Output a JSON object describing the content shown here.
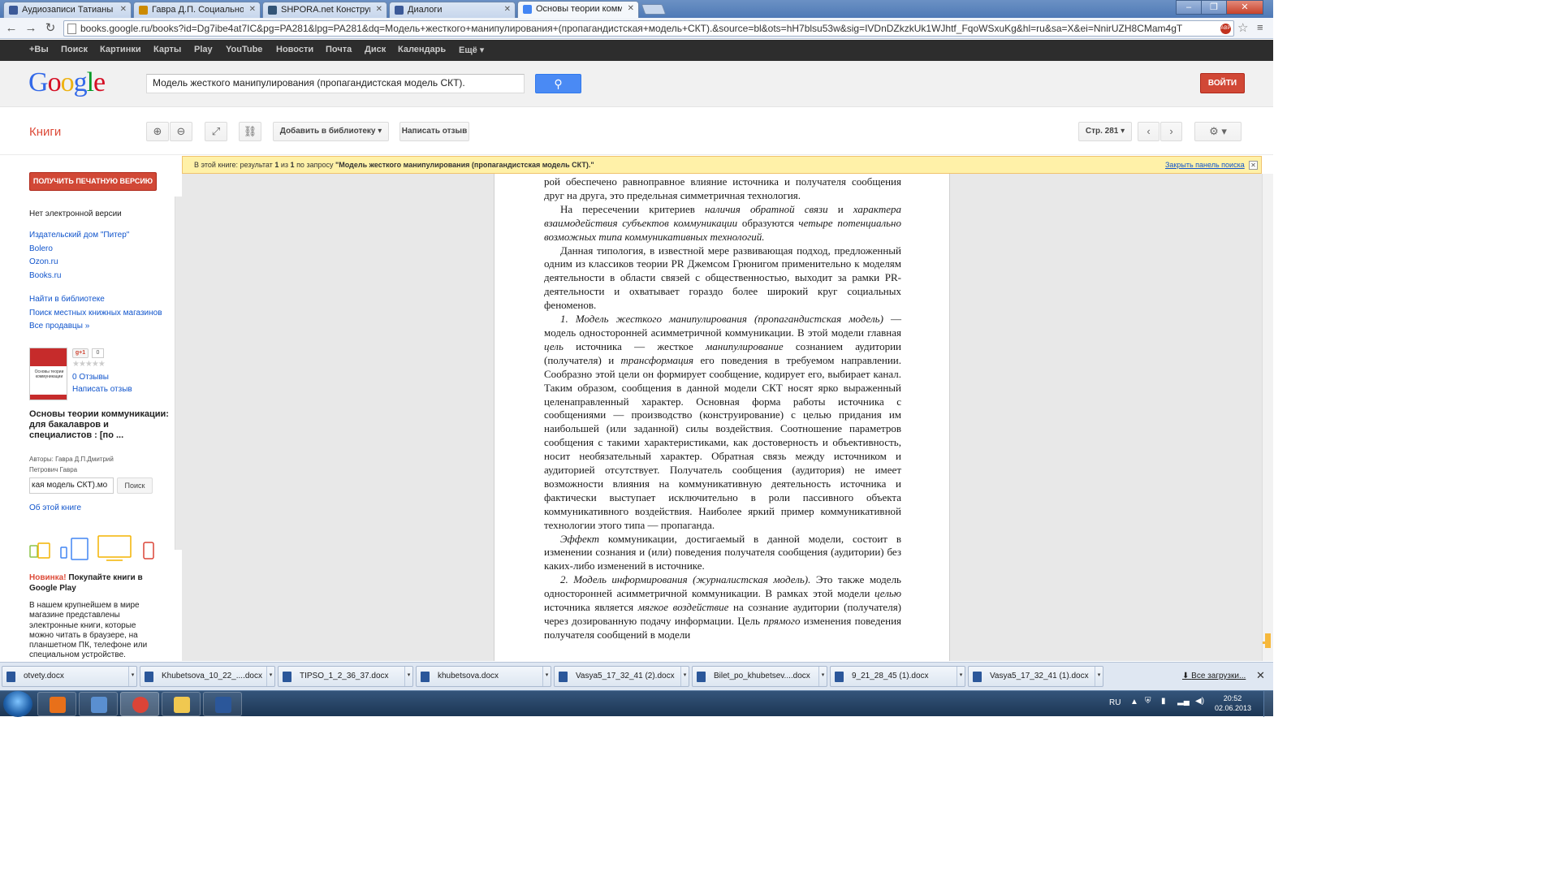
{
  "browser": {
    "tabs": [
      {
        "title": "Аудиозаписи Татианы Го",
        "icon_color": "#3b5998"
      },
      {
        "title": "Гавра Д.П. Социально-к",
        "icon_color": "#cc8a00"
      },
      {
        "title": "SHPORA.net Конструктор",
        "icon_color": "#335577"
      },
      {
        "title": "Диалоги",
        "icon_color": "#3b5998"
      },
      {
        "title": "Основы теории коммуни",
        "icon_color": "#4285f4",
        "active": true
      }
    ],
    "url": "books.google.ru/books?id=Dg7ibe4at7IC&pg=PA281&lpg=PA281&dq=Модель+жесткого+манипулирования+(пропагандистская+модель+СКТ).&source=bl&ots=hH7blsu53w&sig=IVDnDZkzkUk1WJhtf_FqoWSxuKg&hl=ru&sa=X&ei=NnirUZH8CMam4gT",
    "url_host": "books.google.ru",
    "adblock_label": "ABP"
  },
  "gbar": {
    "items": [
      "+Вы",
      "Поиск",
      "Картинки",
      "Карты",
      "Play",
      "YouTube",
      "Новости",
      "Почта",
      "Диск",
      "Календарь",
      "Ещё ▾"
    ]
  },
  "header": {
    "logo_letters": [
      {
        "ch": "G",
        "color": "#3369e8"
      },
      {
        "ch": "o",
        "color": "#d50f25"
      },
      {
        "ch": "o",
        "color": "#eeb211"
      },
      {
        "ch": "g",
        "color": "#3369e8"
      },
      {
        "ch": "l",
        "color": "#009925"
      },
      {
        "ch": "e",
        "color": "#d50f25"
      }
    ],
    "search_value": "Модель жесткого манипулирования (пропагандистская модель СКТ).",
    "signin_label": "ВОЙТИ"
  },
  "books_toolbar": {
    "title": "Книги",
    "add_library": "Добавить в библиотеку",
    "write_review": "Написать отзыв",
    "page_label": "Стр. 281"
  },
  "result_bar": {
    "prefix": "В этой книге: результат",
    "current": "1",
    "of": "из",
    "total": "1",
    "query_prefix": "по запросу",
    "query": "\"Модель жесткого манипулирования (пропагандистская модель СКТ).\"",
    "close_link": "Закрыть панель поиска",
    "close_x": "✕"
  },
  "sidebar": {
    "print_button": "ПОЛУЧИТЬ ПЕЧАТНУЮ ВЕРСИЮ",
    "no_ebook": "Нет электронной версии",
    "sellers": [
      "Издательский дом \"Питер\"",
      "Bolero",
      "Ozon.ru",
      "Books.ru"
    ],
    "library_links": [
      "Найти в библиотеке",
      "Поиск местных книжных магазинов",
      "Все продавцы »"
    ],
    "cover_title": "Основы теории коммуникации",
    "gplus_label": "g+1",
    "gplus_count": "0",
    "stars": "★★★★★",
    "reviews": "0 Отзывы",
    "write_review": "Написать отзыв",
    "book_title": "Основы теории коммуникации: для бакалавров и специалистов : [по ...",
    "authors_line1": "Авторы: Гавра Д.П.Дмитрий",
    "authors_line2": "Петрович Гавра",
    "inbook_search_value": "кая модель СКТ).мо",
    "inbook_search_btn": "Поиск",
    "about_book": "Об этой книге",
    "promo_new": "Новинка!",
    "promo_title": " Покупайте книги в Google Play",
    "promo_desc": "В нашем крупнейшем в мире магазине представлены электронные книги, которые можно читать в браузере, на планшетном ПК, телефоне или специальном устройстве."
  },
  "page": {
    "paragraphs": [
      {
        "noindent": true,
        "html": "рой обеспечено равноправное влияние источника и получателя сообщения друг на друга, это предельная симметричная технология."
      },
      {
        "html": "На пересечении критериев <i>наличия обратной связи</i> и <i>характера взаимодействия субъектов коммуникации</i> образуются <i>четыре потенциально возможных типа коммуникативных технологий.</i>"
      },
      {
        "html": "Данная типология, в известной мере развивающая подход, предложенный одним из классиков теории PR Джемсом Грюнигом применительно к моделям деятельности в области связей с общественностью, выходит за рамки PR-деятельности и охватывает гораздо более широкий круг социальных феноменов."
      },
      {
        "html": "<i>1. Модель жесткого манипулирования (пропагандистская модель)</i> — модель односторонней асимметричной коммуникации. В этой модели главная <i>цель</i> источника — жесткое <i>манипулирование</i> сознанием аудитории (получателя) и <i>трансформация</i> его поведения в требуемом направлении. Сообразно этой цели он формирует сообщение, кодирует его, выбирает канал. Таким образом, сообщения в данной модели СКТ носят ярко выраженный целенаправленный характер. Основная форма работы источника с сообщениями — производство (конструирование) с целью придания им наибольшей (или заданной) силы воздействия. Соотношение параметров сообщения с такими характеристиками, как достоверность и объективность, носит необязательный характер. Обратная связь между источником и аудиторией отсутствует. Получатель сообщения (аудитория) не имеет возможности влияния на коммуникативную деятельность источника и фактически выступает исключительно в роли пассивного объекта коммуникативного воздействия. Наиболее яркий пример коммуникативной технологии этого типа — пропаганда."
      },
      {
        "html": "<i>Эффект</i> коммуникации, достигаемый в данной модели, состоит в изменении сознания и (или) поведения получателя сообщения (аудитории) без каких-либо изменений в источнике."
      },
      {
        "html": "<i>2. Модель информирования (журналистская модель).</i> Это также модель односторонней асимметричной коммуникации. В рамках этой модели <i>целью</i> источника является <i>мягкое воздействие</i> на сознание аудитории (получателя) через дозированную подачу информации. Цель <i>прямого</i> изменения поведения получателя сообщений в модели"
      }
    ]
  },
  "downloads": {
    "files": [
      "otvety.docx",
      "Khubetsova_10_22_....docx",
      "TIPSO_1_2_36_37.docx",
      "khubetsova.docx",
      "Vasya5_17_32_41 (2).docx",
      "Bilet_po_khubetsev....docx",
      "9_21_28_45 (1).docx",
      "Vasya5_17_32_41 (1).docx"
    ],
    "all_downloads": "Все загрузки...",
    "close": "✕"
  },
  "taskbar": {
    "apps": [
      {
        "name": "media-player",
        "color": "#e8701a"
      },
      {
        "name": "program",
        "color": "#5a8fd0"
      },
      {
        "name": "chrome",
        "color": "#db4437",
        "active": true
      },
      {
        "name": "explorer",
        "color": "#f0c850"
      },
      {
        "name": "word",
        "color": "#2b579a"
      }
    ],
    "lang": "RU",
    "time": "20:52",
    "date": "02.06.2013"
  }
}
